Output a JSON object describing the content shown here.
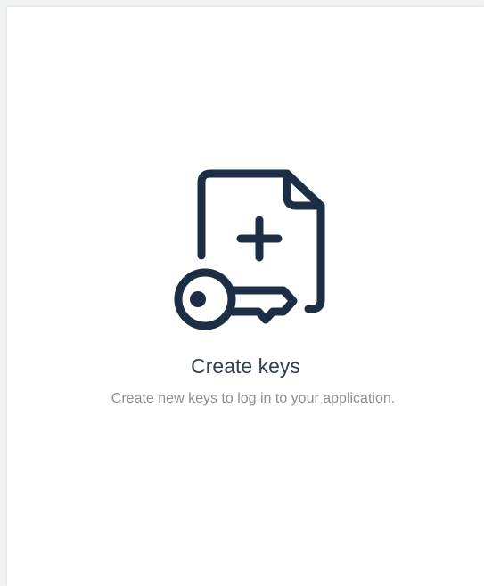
{
  "card": {
    "title": "Create keys",
    "description": "Create new keys to log in to your application.",
    "icon": "key-document-plus-icon"
  },
  "colors": {
    "icon": "#1c2e46",
    "title": "#33404f",
    "description": "#8a9096",
    "card_background": "#ffffff",
    "page_background": "#f2f3f4"
  }
}
